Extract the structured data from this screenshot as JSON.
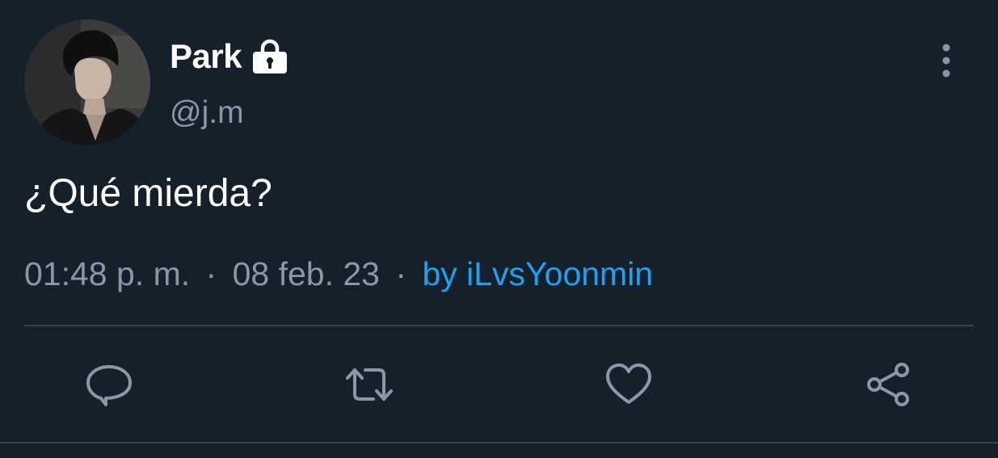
{
  "tweet": {
    "display_name": "Park",
    "handle": "@j.m",
    "text": "¿Qué mierda?",
    "time": "01:48 p. m.",
    "separator": "·",
    "date": "08 feb. 23",
    "via": "by iLvsYoonmin"
  },
  "icons": {
    "protected": "lock-icon",
    "more": "more-vertical-icon",
    "reply": "comment-icon",
    "retweet": "retweet-icon",
    "like": "heart-icon",
    "share": "share-icon"
  },
  "colors": {
    "background": "#15202b",
    "primary_text": "#ffffff",
    "secondary_text": "#8899a6",
    "link": "#1da1f2",
    "divider": "#38444d"
  }
}
